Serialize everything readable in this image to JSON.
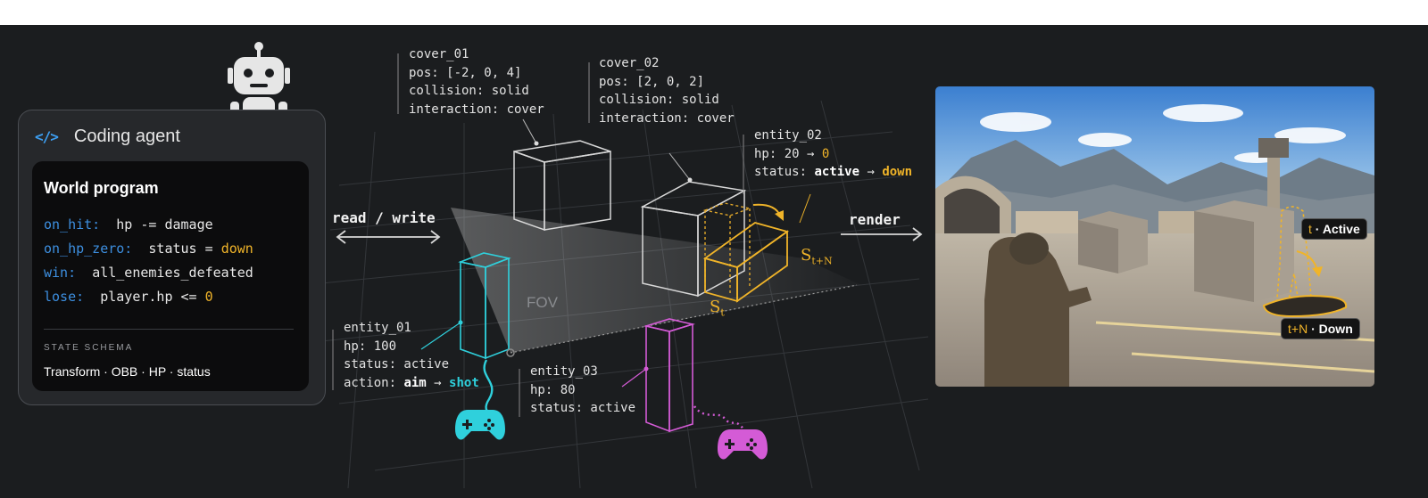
{
  "agent": {
    "icon": "code-icon",
    "icon_glyph": "</>",
    "title": "Coding agent",
    "robot_icon": "robot-icon"
  },
  "world_program": {
    "title": "World program",
    "rules": [
      {
        "key": "on_hit:",
        "expr": "hp -= damage",
        "value": ""
      },
      {
        "key": "on_hp_zero:",
        "expr": "status = ",
        "value": "down"
      },
      {
        "key": "win:",
        "expr": "all_enemies_defeated",
        "value": ""
      },
      {
        "key": "lose:",
        "expr": "player.hp <= ",
        "value": "0"
      }
    ],
    "schema_label": "STATE SCHEMA",
    "schema_value": "Transform · OBB · HP · status"
  },
  "arrows": {
    "read_write": "read / write",
    "render": "render"
  },
  "cover_01": [
    "cover_01",
    "pos: [-2, 0, 4]",
    "collision: solid",
    "interaction: cover"
  ],
  "cover_02": [
    "cover_02",
    "pos: [2, 0, 2]",
    "collision: solid",
    "interaction: cover"
  ],
  "entity_02": {
    "name": "entity_02",
    "hp_prefix": "hp: 20 ",
    "arrow": "→",
    "hp_new": "0",
    "status_prefix": "status: ",
    "status_old": "active",
    "status_new": "down"
  },
  "entity_01": {
    "lines": [
      "entity_01",
      "hp: 100",
      "status: active"
    ],
    "action_prefix": "action: ",
    "action_from": "aim",
    "arrow": "→",
    "action_to": "shot"
  },
  "entity_03": [
    "entity_03",
    "hp: 80",
    "status: active"
  ],
  "fov": "FOV",
  "state_labels": {
    "t_main": "S",
    "t_sub": "t",
    "tn_main": "S",
    "tn_sub": "t+N"
  },
  "scene_badges": {
    "active_time": "t",
    "active_sep": " · ",
    "active_label": "Active",
    "down_time": "t+N",
    "down_sep": " · ",
    "down_label": "Down"
  },
  "colors": {
    "background": "#1b1d1f",
    "accent_blue": "#3d9ff2",
    "accent_yellow": "#f0b429",
    "entity_01": "#2fd0dc",
    "entity_03": "#d45bd6",
    "cover": "#d8d8d8"
  },
  "controller_icons": [
    "gamepad-icon-cyan",
    "gamepad-icon-magenta"
  ]
}
